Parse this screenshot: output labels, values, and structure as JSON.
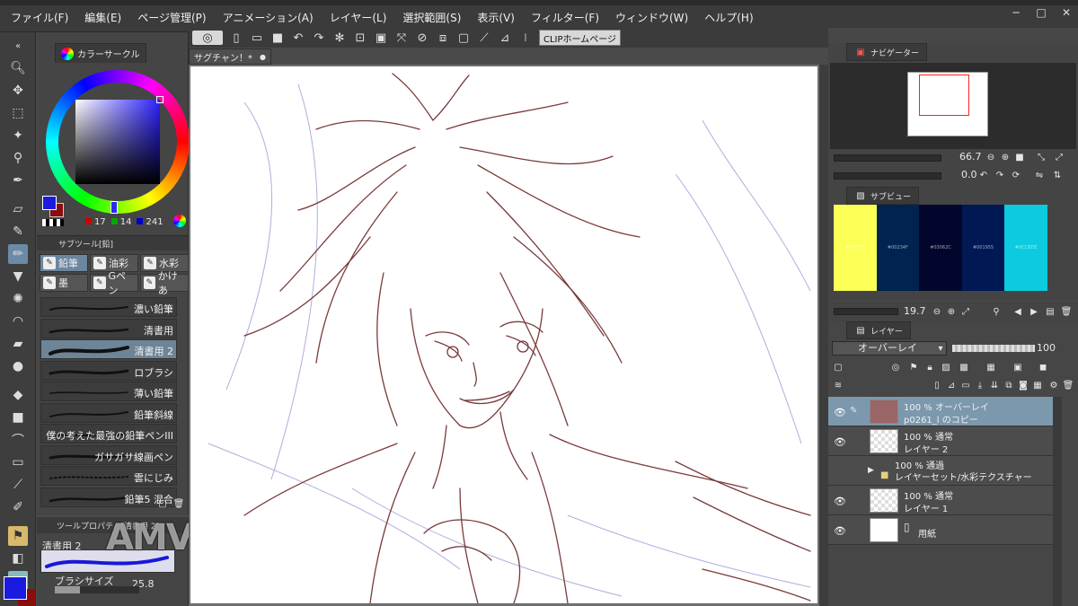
{
  "menu": {
    "items": [
      "ファイル(F)",
      "編集(E)",
      "ページ管理(P)",
      "アニメーション(A)",
      "レイヤー(L)",
      "選択範囲(S)",
      "表示(V)",
      "フィルター(F)",
      "ウィンドウ(W)",
      "ヘルプ(H)"
    ]
  },
  "window_controls": {
    "minimize": "─",
    "maximize": "□",
    "close": "✕"
  },
  "command_bar": {
    "clip_home": "CLIPホームページ"
  },
  "document": {
    "tab_label": "サグチャン！*",
    "close": "●"
  },
  "color_panel": {
    "tab_label": "カラーサークル",
    "main_color": "#1a1ae0",
    "sub_color": "#8a0c0c",
    "r": "17",
    "g": "14",
    "b": "241"
  },
  "sub_tool": {
    "header": "サブツール[鉛]",
    "groups": [
      {
        "label": "鉛筆",
        "icon": "pencil-icon",
        "active": true
      },
      {
        "label": "油彩",
        "icon": "oil-icon",
        "active": false
      },
      {
        "label": "水彩",
        "icon": "watercolor-icon",
        "active": false
      },
      {
        "label": "墨",
        "icon": "ink-icon",
        "active": false
      },
      {
        "label": "Gペン",
        "icon": "gpen-icon",
        "active": false
      },
      {
        "label": "かけあ",
        "icon": "hatch-icon",
        "active": false
      }
    ],
    "brushes": [
      {
        "name": "濃い鉛筆",
        "active": false
      },
      {
        "name": "清書用",
        "active": false
      },
      {
        "name": "清書用 2",
        "active": true
      },
      {
        "name": "ロブラシ",
        "active": false
      },
      {
        "name": "薄い鉛筆",
        "active": false
      },
      {
        "name": "鉛筆斜線",
        "active": false
      },
      {
        "name": "僕の考えた最強の鉛筆ペンIII",
        "active": false
      },
      {
        "name": "ガサガサ線画ペン",
        "active": false
      },
      {
        "name": "雲にじみ",
        "active": false
      },
      {
        "name": "鉛筆5 混合",
        "active": false
      }
    ]
  },
  "tool_property": {
    "header": "ツールプロパティ[清書用 2]",
    "name": "清書用 2",
    "size_label": "ブラシサイズ",
    "size_value": "25.8",
    "size_fraction": 0.3
  },
  "watermark": "AMV",
  "navigator": {
    "tab_label": "ナビゲーター",
    "zoom": "66.7",
    "rotation": "0.0"
  },
  "sub_view": {
    "tab_label": "サブビュー",
    "swatches": [
      {
        "color": "#fcff55",
        "code": "#FCFF55"
      },
      {
        "color": "#00234f",
        "code": "#00234F"
      },
      {
        "color": "#03062c",
        "code": "#03062C"
      },
      {
        "color": "#001955",
        "code": "#001955"
      },
      {
        "color": "#0ccbde",
        "code": "#0CCBDE"
      }
    ],
    "zoom": "19.7"
  },
  "layers": {
    "tab_label": "レイヤー",
    "blend_mode": "オーバーレイ",
    "opacity": "100",
    "items": [
      {
        "line1": "100 % オーバーレイ",
        "line2": "p0261_l のコピー",
        "selected": true,
        "visible": true,
        "thumb": "#9a6666",
        "folder": false
      },
      {
        "line1": "100 % 通常",
        "line2": "レイヤー 2",
        "selected": false,
        "visible": true,
        "thumb": "",
        "folder": false
      },
      {
        "line1": "100 % 通過",
        "line2": "レイヤーセット/水彩テクスチャー",
        "selected": false,
        "visible": false,
        "thumb": "",
        "folder": true
      },
      {
        "line1": "100 % 通常",
        "line2": "レイヤー 1",
        "selected": false,
        "visible": true,
        "thumb": "",
        "folder": false
      },
      {
        "line1": "",
        "line2": "用紙",
        "selected": false,
        "visible": true,
        "thumb": "#ffffff",
        "folder": false,
        "paper": true
      }
    ]
  },
  "colors": {
    "panel_bg": "#454545",
    "accent": "#6b869e",
    "selected_layer": "#7c98ad",
    "sketch_line": "#7a3a3a",
    "blue_line": "#8c8cd0"
  }
}
